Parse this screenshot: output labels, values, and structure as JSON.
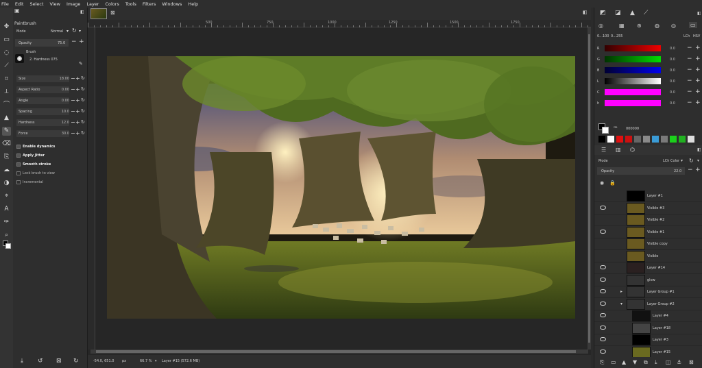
{
  "menubar": [
    "File",
    "Edit",
    "Select",
    "View",
    "Image",
    "Layer",
    "Colors",
    "Tools",
    "Filters",
    "Windows",
    "Help"
  ],
  "tool_options": {
    "title": "Paintbrush",
    "mode_label": "Mode",
    "mode_value": "Normal",
    "opacity_label": "Opacity",
    "opacity_value": "75.0",
    "brush_label": "Brush",
    "brush_name": "2. Hardness 075",
    "rows": [
      {
        "label": "Size",
        "value": "18.00"
      },
      {
        "label": "Aspect Ratio",
        "value": "0.00"
      },
      {
        "label": "Angle",
        "value": "0.00"
      },
      {
        "label": "Spacing",
        "value": "10.0"
      },
      {
        "label": "Hardness",
        "value": "12.0"
      },
      {
        "label": "Force",
        "value": "30.0"
      }
    ],
    "checks": [
      {
        "label": "Enable dynamics",
        "checked": true
      },
      {
        "label": "Apply Jitter",
        "checked": true
      },
      {
        "label": "Smooth stroke",
        "checked": true
      },
      {
        "label": "Lock brush to view",
        "checked": false
      },
      {
        "label": "Incremental",
        "checked": false
      }
    ]
  },
  "ruler_marks": [
    "500",
    "750",
    "1000",
    "1250",
    "1500",
    "1750"
  ],
  "statusbar": {
    "coords": "-54.0, 651.0",
    "unit": "px",
    "zoom": "66.7 %",
    "layer_info": "Layer #15 (572.6 MB)"
  },
  "color_panel": {
    "range": "0...100",
    "range2": "0...255",
    "tabs": [
      "LCh",
      "HSV"
    ],
    "channels": [
      {
        "label": "R",
        "value": "0.0",
        "grad": "linear-gradient(90deg,#300,#e00)"
      },
      {
        "label": "G",
        "value": "0.0",
        "grad": "linear-gradient(90deg,#030,#0d0)"
      },
      {
        "label": "B",
        "value": "0.0",
        "grad": "linear-gradient(90deg,#003,#00e)"
      },
      {
        "label": "L",
        "value": "0.0",
        "grad": "linear-gradient(90deg,#000,#fff)"
      },
      {
        "label": "C",
        "value": "0.0",
        "grad": "linear-gradient(90deg,#f0f,#f0f)"
      },
      {
        "label": "h",
        "value": "0.0",
        "grad": "linear-gradient(90deg,#f0f,#f0f)"
      }
    ],
    "hex": "000000",
    "swatches": [
      "#000000",
      "#ffffff",
      "#e01010",
      "#cc1010",
      "#666666",
      "#8a8a8a",
      "#3a9bd6",
      "#7a7a7a",
      "#1bd01b",
      "#20b020",
      "#dedede"
    ]
  },
  "layers_panel": {
    "mode_label": "Mode",
    "mode_value": "LCh Color",
    "opacity_label": "Opacity",
    "opacity_value": "22.0",
    "layers": [
      {
        "name": "Layer #1",
        "eye": false,
        "thumb": "#000"
      },
      {
        "name": "Visible #3",
        "eye": true,
        "thumb": "#6a5a20"
      },
      {
        "name": "Visible #2",
        "eye": false,
        "thumb": "#6a5a20"
      },
      {
        "name": "Visible #1",
        "eye": true,
        "thumb": "#6a5a20"
      },
      {
        "name": "Visible copy",
        "eye": false,
        "thumb": "#6a5a20"
      },
      {
        "name": "Visible",
        "eye": false,
        "thumb": "#6a5a20"
      },
      {
        "name": "Layer #14",
        "eye": true,
        "thumb": "#2a2020"
      },
      {
        "name": "glow",
        "eye": true,
        "thumb": "#333"
      },
      {
        "name": "Layer Group #1",
        "eye": true,
        "thumb": "#333"
      },
      {
        "name": "Layer Group #2",
        "eye": true,
        "thumb": "#333"
      },
      {
        "name": "Layer #4",
        "eye": true,
        "thumb": "#111"
      },
      {
        "name": "Layer #18",
        "eye": true,
        "thumb": "#444"
      },
      {
        "name": "Layer #3",
        "eye": true,
        "thumb": "#000"
      },
      {
        "name": "Layer #15",
        "eye": true,
        "thumb": "#6a6a20"
      }
    ]
  }
}
